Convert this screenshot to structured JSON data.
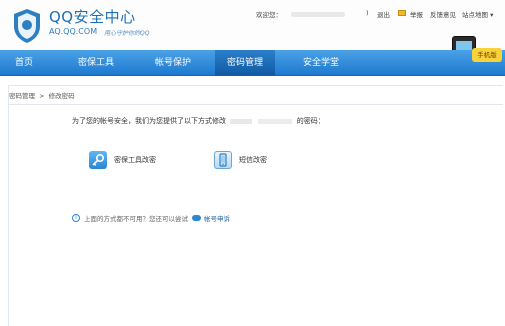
{
  "header": {
    "title": "QQ安全中心",
    "domain": "AQ.QQ.COM",
    "slogan": "用心守护你的QQ",
    "welcome": "欢迎您：",
    "paren": ")",
    "logout": "退出",
    "report": "举报",
    "feedback": "反馈意见",
    "sitemap": "站点地图 ▾",
    "promo_badge": "手机版"
  },
  "nav": {
    "items": [
      "首页",
      "密保工具",
      "帐号保护",
      "密码管理",
      "安全学堂"
    ],
    "active_index": 3
  },
  "breadcrumb": {
    "parent": "密码管理",
    "separator": ">",
    "current": "修改密码"
  },
  "main": {
    "intro_start": "为了您的帐号安全，我们为您提供了以下方式修改",
    "intro_end": "的密码：",
    "methods": [
      {
        "label": "密保工具改密",
        "icon": "key-icon"
      },
      {
        "label": "短信改密",
        "icon": "phone-icon"
      }
    ],
    "alt_text": "上面的方式都不可用？您还可以尝试",
    "alt_link": "帐号申诉"
  },
  "colors": {
    "accent": "#1e79cf",
    "nav_active": "#1059a2",
    "link": "#1c5f9e"
  }
}
